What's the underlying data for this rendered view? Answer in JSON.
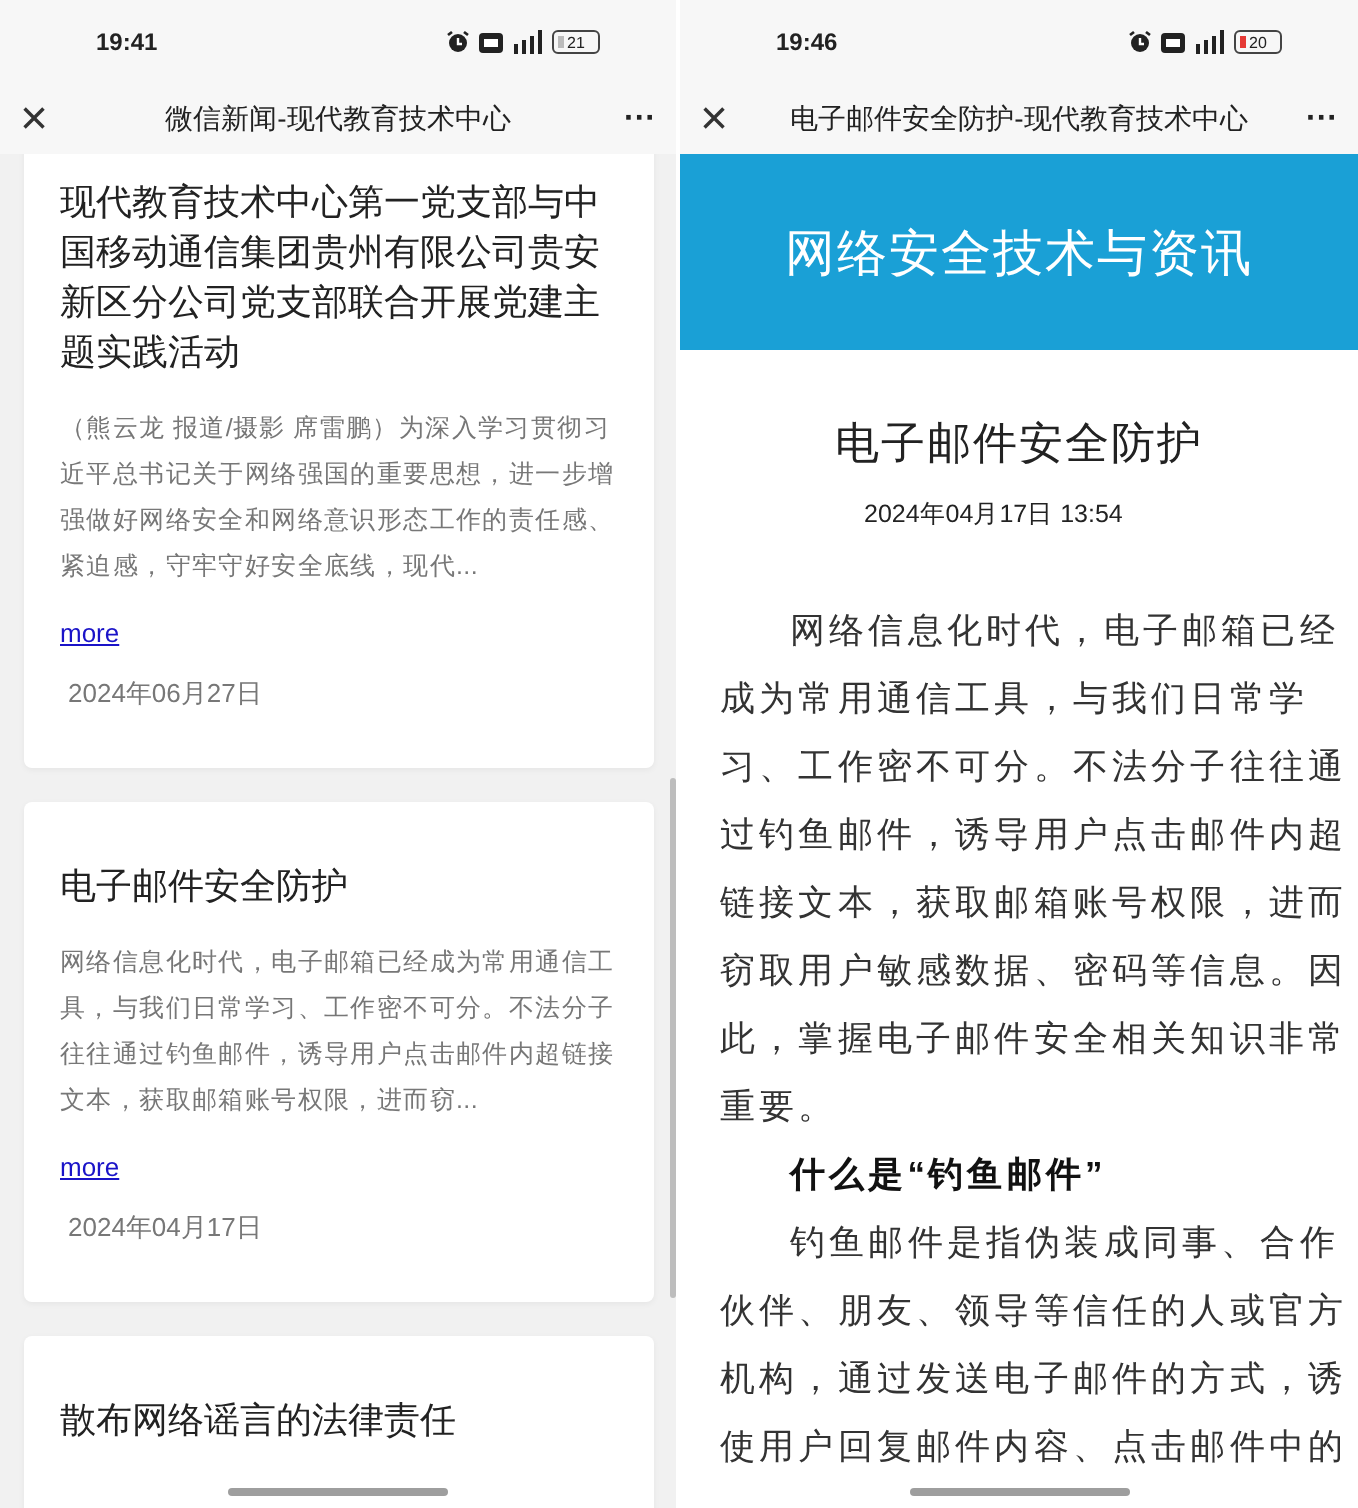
{
  "screens": [
    {
      "kind": "list",
      "status_bar": {
        "time": "19:41",
        "battery": "21",
        "battery_low": false
      },
      "nav": {
        "close": "×",
        "title": "微信新闻-现代教育技术中心",
        "more": "···"
      },
      "articles": [
        {
          "title": "现代教育技术中心第一党支部与中国移动通信集团贵州有限公司贵安新区分公司党支部联合开展党建主题实践活动",
          "summary": "（熊云龙 报道/摄影 席雷鹏）为深入学习贯彻习近平总书记关于网络强国的重要思想，进一步增强做好网络安全和网络意识形态工作的责任感、紧迫感，守牢守好安全底线，现代...",
          "link": "more",
          "date": "2024年06月27日"
        },
        {
          "title": "电子邮件安全防护",
          "summary": "网络信息化时代，电子邮箱已经成为常用通信工具，与我们日常学习、工作密不可分。不法分子往往通过钓鱼邮件，诱导用户点击邮件内超链接文本，获取邮箱账号权限，进而窃...",
          "link": "more",
          "date": "2024年04月17日"
        },
        {
          "title": "散布网络谣言的法律责任"
        }
      ]
    },
    {
      "kind": "article",
      "status_bar": {
        "time": "19:46",
        "battery": "20",
        "battery_low": true
      },
      "nav": {
        "close": "×",
        "title": "电子邮件安全防护-现代教育技术中心",
        "more": "···"
      },
      "banner": "网络安全技术与资讯",
      "article": {
        "title": "电子邮件安全防护",
        "datetime": "2024年04月17日 13:54",
        "paragraphs": [
          {
            "kind": "body",
            "text": "网络信息化时代，电子邮箱已经成为常用通信工具，与我们日常学习、工作密不可分。不法分子往往通过钓鱼邮件，诱导用户点击邮件内超链接文本，获取邮箱账号权限，进而窃取用户敏感数据、密码等信息。因此，掌握电子邮件安全相关知识非常重要。"
          },
          {
            "kind": "heading",
            "text": "什么是“钓鱼邮件”"
          },
          {
            "kind": "body",
            "text": "钓鱼邮件是指伪装成同事、合作伙伴、朋友、领导等信任的人或官方机构，通过发送电子邮件的方式，诱使用户回复邮件内容、点击邮件中的"
          }
        ]
      }
    }
  ]
}
